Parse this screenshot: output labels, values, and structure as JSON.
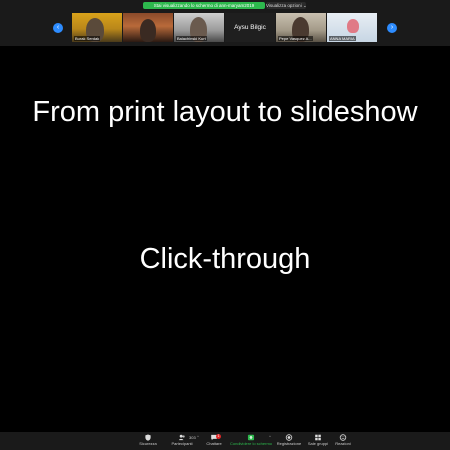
{
  "top_bar": {
    "share_banner": "Stai visualizzando lo schermo di ann-maryam2019",
    "view_options": "Visualizza opzioni ⌄"
  },
  "participants_strip": {
    "prev_icon": "chevron-left-icon",
    "next_icon": "chevron-right-icon",
    "tiles": [
      {
        "name": "Burak Serdak",
        "video": true
      },
      {
        "name": "",
        "video": true
      },
      {
        "name": "Balachinski Kurt",
        "video": true
      },
      {
        "name": "Aysu Bilgic",
        "video": false
      },
      {
        "name": "Pepe Vasquez A...",
        "video": true
      },
      {
        "name": "ANNA MARIA",
        "video": true
      }
    ]
  },
  "slide": {
    "title": "From print layout to slideshow",
    "subtitle": "Click-through"
  },
  "toolbar": {
    "security": {
      "label": "Sicurezza",
      "icon": "shield-icon"
    },
    "participants": {
      "label": "Partecipanti",
      "icon": "people-icon",
      "count": "303"
    },
    "chat": {
      "label": "Chattare",
      "icon": "chat-icon",
      "badge": "1"
    },
    "share": {
      "label": "Condividere lo schermo",
      "icon": "share-screen-icon",
      "accent": "#2db84d"
    },
    "record": {
      "label": "Registrazione",
      "icon": "record-icon"
    },
    "breakout": {
      "label": "Sale gruppi",
      "icon": "grid-icon"
    },
    "reactions": {
      "label": "Reazioni",
      "icon": "smiley-icon"
    }
  }
}
